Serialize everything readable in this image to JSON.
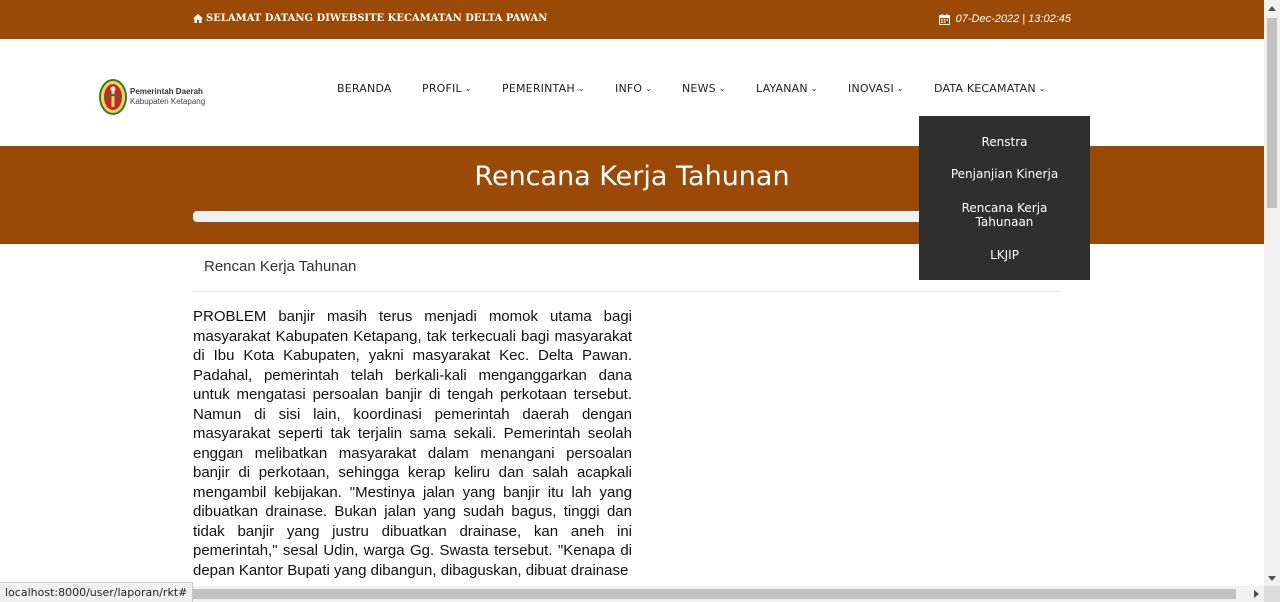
{
  "topbar": {
    "welcome_text": "SELAMAT DATANG DIWEBSITE KECAMATAN DELTA PAWAN",
    "datetime": "07-Dec-2022 | 13:02:45",
    "home_icon": "home-icon",
    "calendar_icon": "calendar-icon"
  },
  "logo": {
    "line1": "Pemerintah Daerah",
    "line2": "Kabupaten Ketapang"
  },
  "nav": {
    "items": [
      {
        "label": "BERANDA",
        "dropdown": false
      },
      {
        "label": "PROFIL",
        "dropdown": true
      },
      {
        "label": "PEMERINTAH",
        "dropdown": true
      },
      {
        "label": "INFO",
        "dropdown": true
      },
      {
        "label": "NEWS",
        "dropdown": true
      },
      {
        "label": "LAYANAN",
        "dropdown": true
      },
      {
        "label": "INOVASI",
        "dropdown": true
      },
      {
        "label": "DATA KECAMATAN",
        "dropdown": true
      }
    ],
    "chevron": "⌄"
  },
  "dropdown": {
    "items": [
      {
        "label": "Renstra"
      },
      {
        "label": "Penjanjian Kinerja"
      },
      {
        "label": "Rencana Kerja Tahunaan"
      },
      {
        "label": "LKJIP"
      }
    ]
  },
  "banner": {
    "title": "Rencana Kerja Tahunan"
  },
  "content": {
    "subhead": "Rencan Kerja Tahunan",
    "article": "PROBLEM banjir masih terus menjadi momok utama bagi masyarakat Kabupaten Ketapang, tak terkecuali bagi masyarakat di Ibu Kota Kabupaten, yakni masyarakat Kec. Delta Pawan. Padahal, pemerintah telah berkali-kali menganggarkan dana untuk mengatasi persoalan banjir di tengah perkotaan tersebut. Namun di sisi lain, koordinasi pemerintah daerah dengan masyarakat seperti tak terjalin sama sekali. Pemerintah seolah enggan melibatkan masyarakat dalam menangani persoalan banjir di perkotaan, sehingga kerap keliru dan salah acapkali mengambil kebijakan. \"Mestinya jalan yang banjir itu lah yang dibuatkan drainase. Bukan jalan yang sudah bagus, tinggi dan tidak banjir yang justru dibuatkan drainase, kan aneh ini pemerintah,\" sesal Udin, warga Gg. Swasta tersebut. \"Kenapa di depan Kantor Bupati yang dibangun, dibaguskan, dibuat drainase"
  },
  "status": {
    "url": "localhost:8000/user/laporan/rkt#"
  },
  "colors": {
    "brand": "#9a4a06",
    "dropdown_bg": "#2f2f2f"
  }
}
